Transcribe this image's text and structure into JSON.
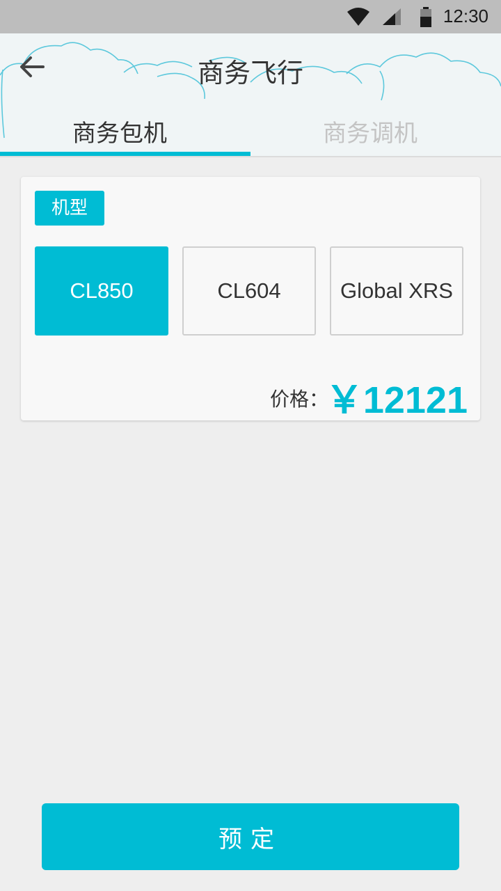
{
  "status_bar": {
    "time": "12:30",
    "icons": [
      "wifi-icon",
      "signal-icon",
      "battery-icon"
    ]
  },
  "header": {
    "title": "商务飞行",
    "back_icon": "arrow-left-icon",
    "background_decoration": "cloud-outline-icon"
  },
  "tabs": [
    {
      "label": "商务包机",
      "active": true
    },
    {
      "label": "商务调机",
      "active": false
    }
  ],
  "card": {
    "section_label": "机型",
    "models": [
      {
        "label": "CL850",
        "selected": true
      },
      {
        "label": "CL604",
        "selected": false
      },
      {
        "label": "Global XRS",
        "selected": false
      }
    ],
    "price_label": "价格：",
    "price_value": "￥12121"
  },
  "book_button": {
    "label": "预定"
  },
  "colors": {
    "accent": "#00bcd4",
    "status_bar": "#bdbdbd",
    "header_bg": "#f0f5f6",
    "page_bg": "#eeeeee",
    "inactive_tab": "#c4c4c4"
  }
}
